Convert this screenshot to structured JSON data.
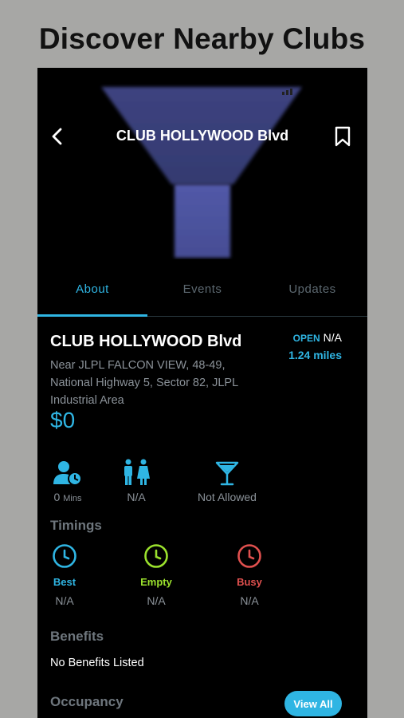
{
  "promo": {
    "title": "Discover Nearby Clubs"
  },
  "header": {
    "title": "CLUB HOLLYWOOD Blvd"
  },
  "tabs": [
    {
      "label": "About",
      "active": true
    },
    {
      "label": "Events",
      "active": false
    },
    {
      "label": "Updates",
      "active": false
    }
  ],
  "club": {
    "name": "CLUB HOLLYWOOD Blvd",
    "open_label": "OPEN",
    "open_value": "N/A",
    "distance": "1.24 miles",
    "address": "Near JLPL FALCON VIEW, 48-49, National Highway 5, Sector 82, JLPL Industrial Area",
    "price": "$0"
  },
  "stats": {
    "wait_value": "0",
    "wait_unit": "Mins",
    "gender": "N/A",
    "drinks": "Not Allowed"
  },
  "timings": {
    "title": "Timings",
    "items": [
      {
        "label": "Best",
        "value": "N/A",
        "color": "#2fb5e3"
      },
      {
        "label": "Empty",
        "value": "N/A",
        "color": "#9be22d"
      },
      {
        "label": "Busy",
        "value": "N/A",
        "color": "#e0504e"
      }
    ]
  },
  "benefits": {
    "title": "Benefits",
    "text": "No Benefits Listed"
  },
  "occupancy": {
    "title": "Occupancy",
    "button": "View All"
  },
  "icons": [
    "back-arrow-icon",
    "bookmark-icon",
    "person-clock-icon",
    "male-female-icon",
    "cocktail-glass-icon",
    "clock-icon"
  ],
  "colors": {
    "accent": "#2fb5e3",
    "spotlight": "#4d54a0",
    "background": "#000000"
  }
}
